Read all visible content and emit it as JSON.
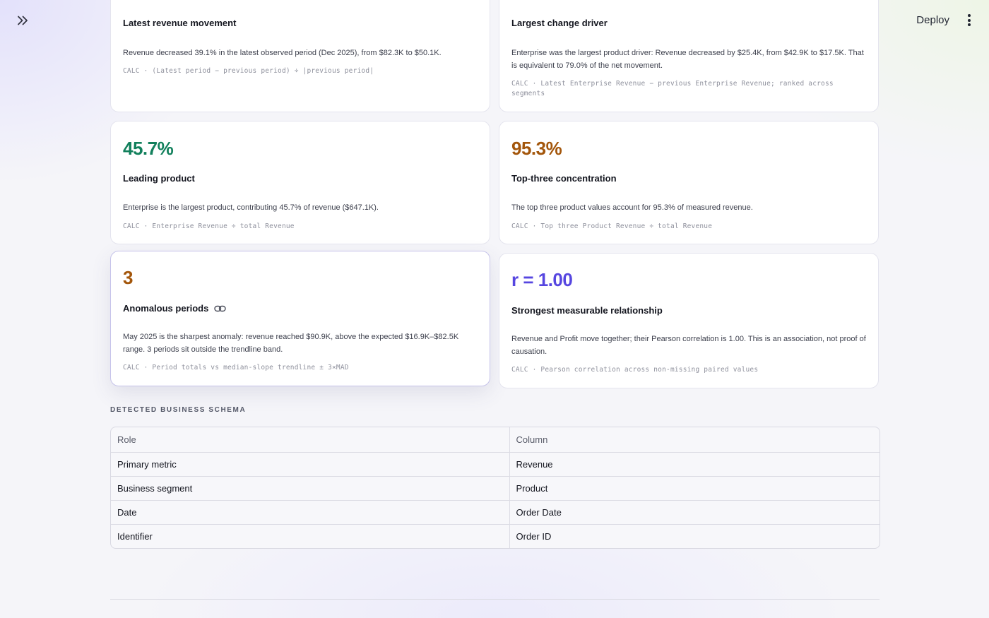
{
  "header": {
    "deploy_label": "Deploy"
  },
  "icons": {
    "expand": "chevrons-right-icon",
    "menu": "kebab-menu-icon",
    "link": "link-icon"
  },
  "colors": {
    "positive": "#12805c",
    "warning": "#a3560b",
    "accent": "#5646e0"
  },
  "cards": [
    {
      "title": "Latest revenue movement",
      "description": "Revenue decreased 39.1% in the latest observed period (Dec 2025), from $82.3K to $50.1K.",
      "calc": "CALC · (Latest period − previous period) ÷ |previous period|"
    },
    {
      "title": "Largest change driver",
      "description": "Enterprise was the largest product driver: Revenue decreased by $25.4K, from $42.9K to $17.5K. That is equivalent to 79.0% of the net movement.",
      "calc": "CALC · Latest Enterprise Revenue − previous Enterprise Revenue; ranked across segments"
    },
    {
      "metric": "45.7%",
      "title": "Leading product",
      "description": "Enterprise is the largest product, contributing 45.7% of revenue ($647.1K).",
      "calc": "CALC · Enterprise Revenue ÷ total Revenue"
    },
    {
      "metric": "95.3%",
      "title": "Top-three concentration",
      "description": "The top three product values account for 95.3% of measured revenue.",
      "calc": "CALC · Top three Product Revenue ÷ total Revenue"
    },
    {
      "metric": "3",
      "title": "Anomalous periods",
      "description": "May 2025 is the sharpest anomaly: revenue reached $90.9K, above the expected $16.9K–$82.5K range. 3 periods sit outside the trendline band.",
      "calc": "CALC · Period totals vs median-slope trendline ± 3×MAD"
    },
    {
      "metric": "r = 1.00",
      "title": "Strongest measurable relationship",
      "description": "Revenue and Profit move together; their Pearson correlation is 1.00. This is an association, not proof of causation.",
      "calc": "CALC · Pearson correlation across non-missing paired values"
    }
  ],
  "schema": {
    "section_title": "DETECTED BUSINESS SCHEMA",
    "headers": [
      "Role",
      "Column"
    ],
    "rows": [
      [
        "Primary metric",
        "Revenue"
      ],
      [
        "Business segment",
        "Product"
      ],
      [
        "Date",
        "Order Date"
      ],
      [
        "Identifier",
        "Order ID"
      ]
    ]
  }
}
